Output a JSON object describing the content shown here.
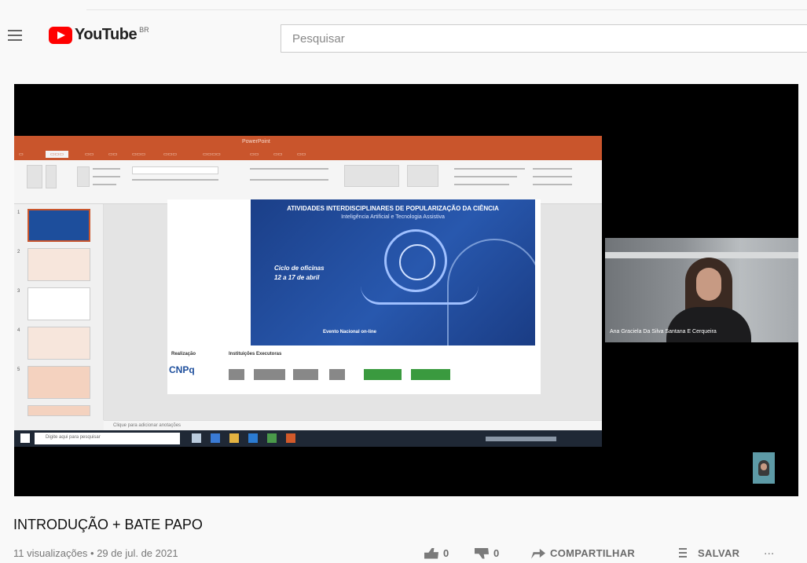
{
  "header": {
    "logo_text": "YouTube",
    "country_code": "BR",
    "search_placeholder": "Pesquisar"
  },
  "player": {
    "screen_share": {
      "app": "PowerPoint",
      "slide": {
        "title": "ATIVIDADES INTERDISCIPLINARES DE POPULARIZAÇÃO DA CIÊNCIA",
        "subtitle": "Inteligência Artificial e Tecnologia Assistiva",
        "ciclo_line1": "Ciclo de oficinas",
        "ciclo_line2": "12 a 17 de abril",
        "footer": "Evento Nacional on-line",
        "realizacao_label": "Realização",
        "instituicoes_label": "Instituições Executoras",
        "cnpq_logo": "CNPq"
      },
      "notes_placeholder": "Clique para adicionar anotações",
      "taskbar_search": "Digite aqui para pesquisar"
    },
    "participant_name": "Ana Graciela Da Silva Santana E Cerqueira"
  },
  "video": {
    "title": "INTRODUÇÃO + BATE PAPO",
    "meta": "11 visualizações • 29 de jul. de 2021",
    "likes": "0",
    "dislikes": "0",
    "share_label": "COMPARTILHAR",
    "save_label": "SALVAR",
    "more_label": "..."
  },
  "icons": {
    "menu": "menu-icon",
    "like": "thumbs-up-icon",
    "dislike": "thumbs-down-icon",
    "share": "share-icon",
    "save": "playlist-add-icon",
    "more": "more-horizontal-icon"
  },
  "colors": {
    "brand_red": "#ff0000",
    "ppt_orange": "#c9552c",
    "slide_blue": "#1d4e9c"
  }
}
